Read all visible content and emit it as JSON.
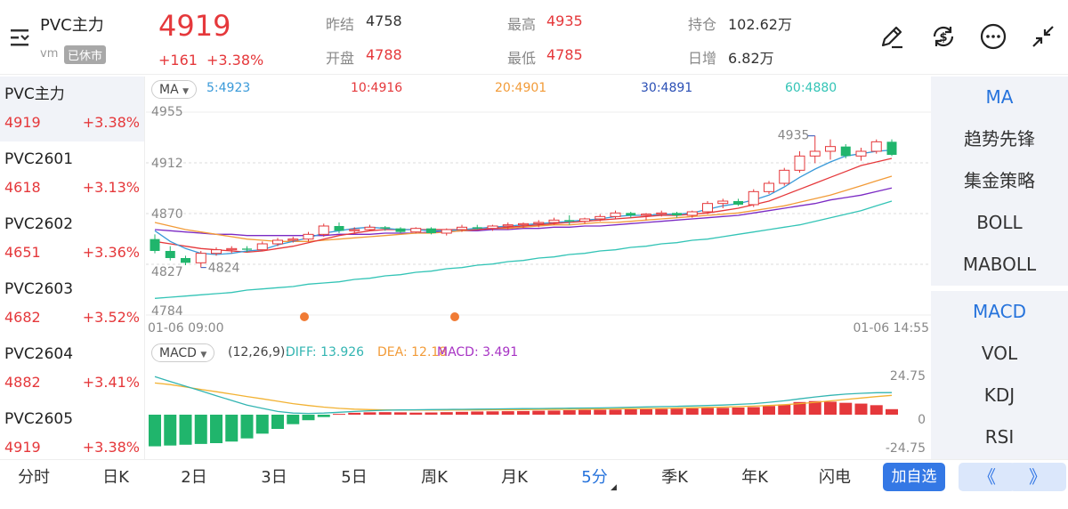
{
  "header": {
    "title": "PVC主力",
    "exchange": "vm",
    "status": "已休市",
    "price": "4919",
    "change": "+161",
    "change_pct": "+3.38%",
    "quotes": [
      {
        "key": "昨结",
        "value": "4758",
        "color": "#333333"
      },
      {
        "key": "最高",
        "value": "4935",
        "color": "#e5383b"
      },
      {
        "key": "持仓",
        "value": "102.62万",
        "color": "#333333"
      },
      {
        "key": "开盘",
        "value": "4788",
        "color": "#e5383b"
      },
      {
        "key": "最低",
        "value": "4785",
        "color": "#e5383b"
      },
      {
        "key": "日增",
        "value": "6.82万",
        "color": "#333333"
      }
    ],
    "icons": [
      "pen-icon",
      "currency-exchange-icon",
      "more-icon",
      "collapse-icon"
    ]
  },
  "contracts": [
    {
      "name": "PVC主力",
      "price": "4919",
      "pct": "+3.38%"
    },
    {
      "name": "PVC2601",
      "price": "4618",
      "pct": "+3.13%"
    },
    {
      "name": "PVC2602",
      "price": "4651",
      "pct": "+3.36%"
    },
    {
      "name": "PVC2603",
      "price": "4682",
      "pct": "+3.52%"
    },
    {
      "name": "PVC2604",
      "price": "4882",
      "pct": "+3.41%"
    },
    {
      "name": "PVC2605",
      "price": "4919",
      "pct": "+3.38%"
    }
  ],
  "main_chart": {
    "ma_selector": "MA",
    "ma_labels": [
      {
        "text": "5:4923",
        "color": "#3a9ad9"
      },
      {
        "text": "10:4916",
        "color": "#e5383b"
      },
      {
        "text": "20:4901",
        "color": "#f29b38"
      },
      {
        "text": "30:4891",
        "color": "#2a4fb5"
      },
      {
        "text": "60:4880",
        "color": "#33c4b6"
      }
    ],
    "y_ticks": [
      "4955",
      "4912",
      "4870",
      "4827",
      "4784"
    ],
    "time_start": "01-06 09:00",
    "time_end": "01-06 14:55",
    "max_label": "4935",
    "min_label": "4824"
  },
  "macd": {
    "selector": "MACD",
    "params": "(12,26,9):",
    "diff": "DIFF: 13.926",
    "dea": "DEA: 12.18",
    "macd": "MACD: 3.491",
    "y_ticks": [
      "24.75",
      "0",
      "-24.75"
    ]
  },
  "indicators": [
    {
      "label": "MA",
      "active": true
    },
    {
      "label": "趋势先锋",
      "active": false
    },
    {
      "label": "集金策略",
      "active": false
    },
    {
      "label": "BOLL",
      "active": false
    },
    {
      "label": "MABOLL",
      "active": false
    },
    {
      "label": "MACD",
      "active": true
    },
    {
      "label": "VOL",
      "active": false
    },
    {
      "label": "KDJ",
      "active": false
    },
    {
      "label": "RSI",
      "active": false
    }
  ],
  "periods": [
    {
      "label": "分时",
      "active": false
    },
    {
      "label": "日K",
      "active": false
    },
    {
      "label": "2日",
      "active": false
    },
    {
      "label": "3日",
      "active": false
    },
    {
      "label": "5日",
      "active": false
    },
    {
      "label": "周K",
      "active": false
    },
    {
      "label": "月K",
      "active": false
    },
    {
      "label": "5分",
      "active": true
    },
    {
      "label": "季K",
      "active": false
    },
    {
      "label": "年K",
      "active": false
    },
    {
      "label": "闪电",
      "active": false
    }
  ],
  "actions": {
    "add_favorite": "加自选",
    "prev": "《",
    "next": "》"
  },
  "colors": {
    "up": "#e5383b",
    "down": "#20b56c",
    "accent": "#2673dc"
  },
  "chart_data": {
    "type": "candlestick",
    "ylim": [
      4784,
      4955
    ],
    "candles": [
      {
        "o": 4848,
        "h": 4852,
        "l": 4836,
        "c": 4838
      },
      {
        "o": 4838,
        "h": 4842,
        "l": 4830,
        "c": 4832
      },
      {
        "o": 4832,
        "h": 4834,
        "l": 4826,
        "c": 4828
      },
      {
        "o": 4828,
        "h": 4838,
        "l": 4824,
        "c": 4836
      },
      {
        "o": 4836,
        "h": 4841,
        "l": 4834,
        "c": 4839
      },
      {
        "o": 4839,
        "h": 4842,
        "l": 4836,
        "c": 4840
      },
      {
        "o": 4840,
        "h": 4842,
        "l": 4837,
        "c": 4839
      },
      {
        "o": 4839,
        "h": 4846,
        "l": 4838,
        "c": 4844
      },
      {
        "o": 4844,
        "h": 4849,
        "l": 4842,
        "c": 4847
      },
      {
        "o": 4847,
        "h": 4850,
        "l": 4845,
        "c": 4848
      },
      {
        "o": 4848,
        "h": 4854,
        "l": 4846,
        "c": 4852
      },
      {
        "o": 4852,
        "h": 4861,
        "l": 4850,
        "c": 4859
      },
      {
        "o": 4859,
        "h": 4862,
        "l": 4853,
        "c": 4855
      },
      {
        "o": 4855,
        "h": 4858,
        "l": 4852,
        "c": 4856
      },
      {
        "o": 4856,
        "h": 4860,
        "l": 4855,
        "c": 4858
      },
      {
        "o": 4858,
        "h": 4859,
        "l": 4855,
        "c": 4857
      },
      {
        "o": 4857,
        "h": 4858,
        "l": 4853,
        "c": 4854
      },
      {
        "o": 4854,
        "h": 4858,
        "l": 4853,
        "c": 4857
      },
      {
        "o": 4857,
        "h": 4858,
        "l": 4852,
        "c": 4853
      },
      {
        "o": 4853,
        "h": 4857,
        "l": 4851,
        "c": 4856
      },
      {
        "o": 4856,
        "h": 4860,
        "l": 4854,
        "c": 4858
      },
      {
        "o": 4858,
        "h": 4860,
        "l": 4856,
        "c": 4857
      },
      {
        "o": 4857,
        "h": 4860,
        "l": 4855,
        "c": 4859
      },
      {
        "o": 4859,
        "h": 4862,
        "l": 4856,
        "c": 4860
      },
      {
        "o": 4860,
        "h": 4862,
        "l": 4857,
        "c": 4861
      },
      {
        "o": 4861,
        "h": 4864,
        "l": 4858,
        "c": 4862
      },
      {
        "o": 4862,
        "h": 4866,
        "l": 4860,
        "c": 4864
      },
      {
        "o": 4864,
        "h": 4868,
        "l": 4860,
        "c": 4863
      },
      {
        "o": 4863,
        "h": 4866,
        "l": 4861,
        "c": 4865
      },
      {
        "o": 4865,
        "h": 4869,
        "l": 4863,
        "c": 4867
      },
      {
        "o": 4867,
        "h": 4872,
        "l": 4865,
        "c": 4870
      },
      {
        "o": 4870,
        "h": 4871,
        "l": 4866,
        "c": 4868
      },
      {
        "o": 4868,
        "h": 4870,
        "l": 4864,
        "c": 4869
      },
      {
        "o": 4869,
        "h": 4872,
        "l": 4867,
        "c": 4870
      },
      {
        "o": 4870,
        "h": 4871,
        "l": 4866,
        "c": 4868
      },
      {
        "o": 4868,
        "h": 4872,
        "l": 4866,
        "c": 4871
      },
      {
        "o": 4871,
        "h": 4880,
        "l": 4869,
        "c": 4878
      },
      {
        "o": 4878,
        "h": 4882,
        "l": 4874,
        "c": 4880
      },
      {
        "o": 4880,
        "h": 4882,
        "l": 4876,
        "c": 4877
      },
      {
        "o": 4877,
        "h": 4890,
        "l": 4875,
        "c": 4888
      },
      {
        "o": 4888,
        "h": 4897,
        "l": 4886,
        "c": 4895
      },
      {
        "o": 4895,
        "h": 4908,
        "l": 4893,
        "c": 4906
      },
      {
        "o": 4906,
        "h": 4922,
        "l": 4904,
        "c": 4918
      },
      {
        "o": 4918,
        "h": 4935,
        "l": 4912,
        "c": 4922
      },
      {
        "o": 4922,
        "h": 4932,
        "l": 4915,
        "c": 4926
      },
      {
        "o": 4926,
        "h": 4928,
        "l": 4916,
        "c": 4918
      },
      {
        "o": 4918,
        "h": 4925,
        "l": 4914,
        "c": 4922
      },
      {
        "o": 4922,
        "h": 4932,
        "l": 4920,
        "c": 4930
      },
      {
        "o": 4930,
        "h": 4932,
        "l": 4918,
        "c": 4919
      }
    ],
    "ma5": [
      4855,
      4846,
      4840,
      4836,
      4835,
      4836,
      4838,
      4839,
      4843,
      4846,
      4849,
      4853,
      4855,
      4857,
      4858,
      4857,
      4856,
      4856,
      4855,
      4855,
      4856,
      4857,
      4858,
      4859,
      4860,
      4861,
      4862,
      4863,
      4864,
      4865,
      4867,
      4868,
      4868,
      4869,
      4869,
      4870,
      4873,
      4876,
      4878,
      4881,
      4885,
      4892,
      4900,
      4907,
      4913,
      4918,
      4920,
      4922,
      4923
    ],
    "ma10": [
      4846,
      4844,
      4842,
      4840,
      4839,
      4838,
      4837,
      4838,
      4840,
      4842,
      4845,
      4848,
      4851,
      4853,
      4855,
      4856,
      4856,
      4856,
      4856,
      4856,
      4856,
      4856,
      4857,
      4858,
      4859,
      4860,
      4861,
      4862,
      4863,
      4864,
      4865,
      4866,
      4867,
      4868,
      4868,
      4869,
      4870,
      4872,
      4874,
      4877,
      4880,
      4885,
      4890,
      4895,
      4900,
      4905,
      4910,
      4913,
      4916
    ],
    "ma20": [
      4862,
      4859,
      4856,
      4854,
      4852,
      4850,
      4848,
      4847,
      4846,
      4846,
      4846,
      4847,
      4848,
      4849,
      4850,
      4851,
      4852,
      4853,
      4853,
      4854,
      4855,
      4856,
      4857,
      4857,
      4858,
      4859,
      4860,
      4860,
      4861,
      4862,
      4862,
      4863,
      4864,
      4865,
      4866,
      4867,
      4868,
      4869,
      4870,
      4872,
      4874,
      4876,
      4879,
      4882,
      4885,
      4889,
      4893,
      4897,
      4901
    ],
    "ma30": [
      4856,
      4855,
      4854,
      4853,
      4852,
      4852,
      4851,
      4851,
      4851,
      4851,
      4851,
      4851,
      4852,
      4852,
      4852,
      4853,
      4853,
      4853,
      4854,
      4854,
      4855,
      4855,
      4856,
      4856,
      4857,
      4857,
      4858,
      4858,
      4859,
      4859,
      4860,
      4861,
      4862,
      4863,
      4864,
      4865,
      4866,
      4867,
      4868,
      4870,
      4872,
      4874,
      4876,
      4878,
      4881,
      4883,
      4885,
      4888,
      4891
    ],
    "ma60": [
      4798,
      4799,
      4800,
      4801,
      4802,
      4803,
      4805,
      4806,
      4807,
      4808,
      4810,
      4811,
      4812,
      4814,
      4815,
      4817,
      4818,
      4820,
      4821,
      4823,
      4824,
      4826,
      4827,
      4829,
      4830,
      4832,
      4833,
      4835,
      4836,
      4838,
      4839,
      4841,
      4842,
      4844,
      4845,
      4847,
      4848,
      4850,
      4852,
      4854,
      4856,
      4858,
      4860,
      4863,
      4866,
      4869,
      4872,
      4876,
      4880
    ],
    "macd_bar": [
      -20,
      -19.5,
      -19,
      -18.5,
      -18,
      -17,
      -15,
      -12,
      -9,
      -6,
      -3.5,
      -1.5,
      0.5,
      1.2,
      1.5,
      1.6,
      1.5,
      1.3,
      1.4,
      1.6,
      1.8,
      2.0,
      2.1,
      2.2,
      2.3,
      2.5,
      2.6,
      2.8,
      3.0,
      3.1,
      3.2,
      3.4,
      3.5,
      3.6,
      3.8,
      4.0,
      4.2,
      4.3,
      4.5,
      4.8,
      5.5,
      6.5,
      8.0,
      8.6,
      8.2,
      7.5,
      7.0,
      6.0,
      3.491
    ],
    "diff": [
      24,
      21,
      18,
      15,
      12,
      9,
      6,
      4,
      2,
      1,
      0.8,
      1,
      1.5,
      2,
      2.5,
      2.8,
      3,
      3.1,
      3.2,
      3.3,
      3.4,
      3.5,
      3.6,
      3.7,
      3.8,
      3.9,
      4,
      4.1,
      4.2,
      4.3,
      4.5,
      4.7,
      4.9,
      5.1,
      5.3,
      5.5,
      5.8,
      6.1,
      6.5,
      7,
      7.8,
      8.8,
      10,
      11.2,
      12.2,
      13,
      13.5,
      13.9,
      13.926
    ],
    "dea": [
      20,
      19,
      17.5,
      16,
      14.5,
      13,
      11.5,
      10,
      8.5,
      7,
      5.8,
      4.8,
      4,
      3.5,
      3.2,
      3,
      2.9,
      2.9,
      2.9,
      2.9,
      3,
      3,
      3.1,
      3.1,
      3.2,
      3.3,
      3.3,
      3.4,
      3.5,
      3.6,
      3.7,
      3.8,
      3.9,
      4,
      4.2,
      4.4,
      4.6,
      4.8,
      5.1,
      5.4,
      5.8,
      6.3,
      7,
      7.8,
      8.7,
      9.6,
      10.5,
      11.4,
      12.18
    ],
    "macd_ylim": [
      -24.75,
      24.75
    ]
  }
}
